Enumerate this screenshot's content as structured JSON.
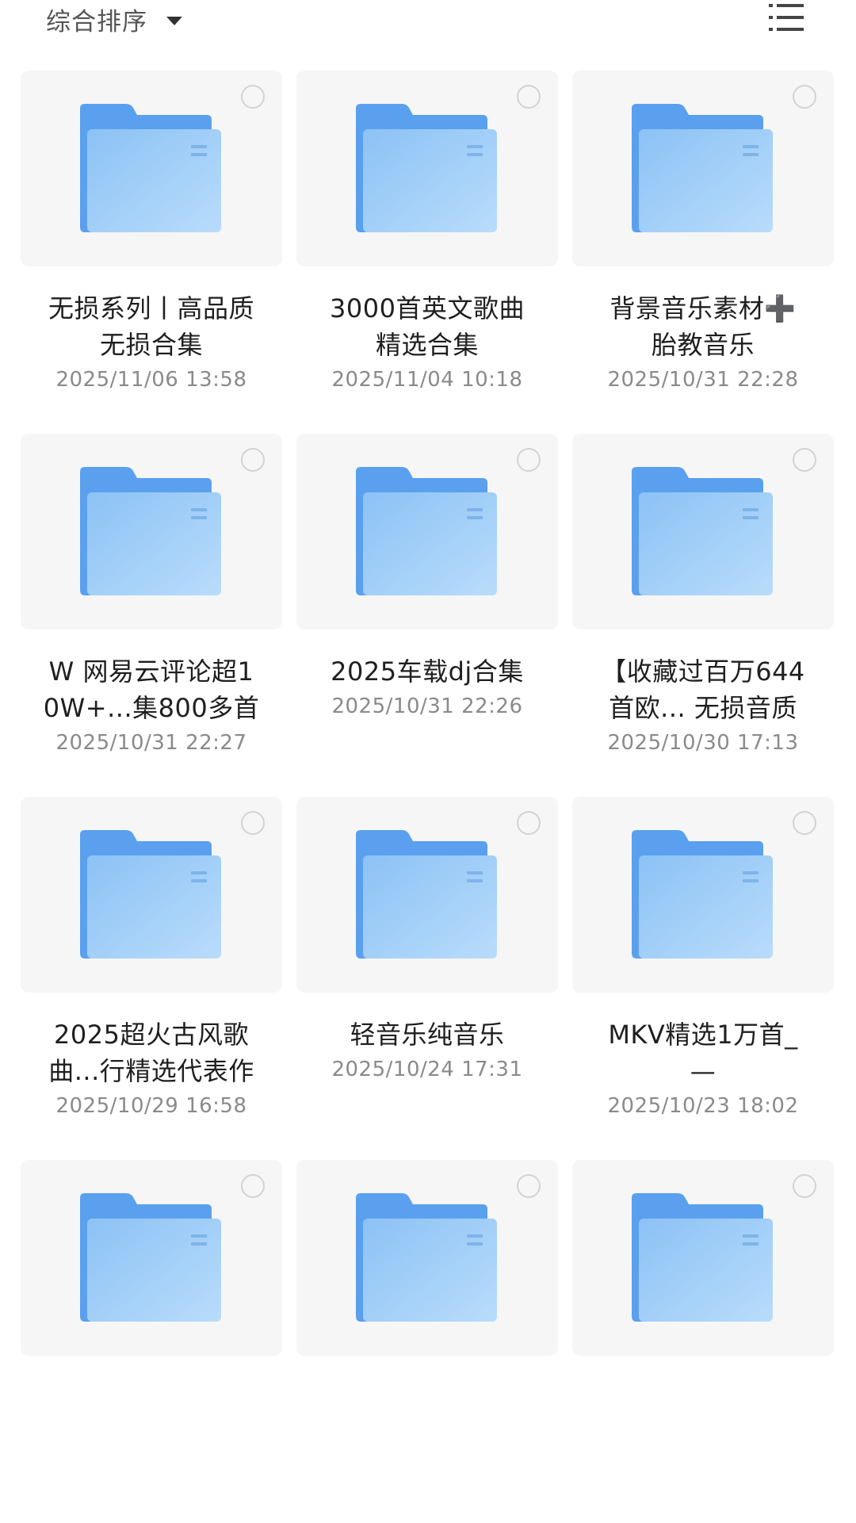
{
  "toolbar": {
    "sort_label": "综合排序",
    "sort_icon": "caret-down-icon",
    "view_toggle_icon": "list-view-icon"
  },
  "colors": {
    "folder_back": "#5aa0ef",
    "folder_front_top": "#8cc2f5",
    "folder_front_bottom": "#b9dcfb",
    "card_bg": "#f6f6f6",
    "select_circle": "#d3d3d3",
    "date_text": "#8a8a8a"
  },
  "folders": [
    {
      "name_lines": [
        "无损系列丨高品质",
        "无损合集"
      ],
      "date": "2025/11/06 13:58"
    },
    {
      "name_lines": [
        "3000首英文歌曲",
        "精选合集"
      ],
      "date": "2025/11/04 10:18"
    },
    {
      "name_lines": [
        "背景音乐素材➕",
        "胎教音乐"
      ],
      "date": "2025/10/31 22:28"
    },
    {
      "name_lines": [
        "W 网易云评论超1",
        "0W+...集800多首"
      ],
      "date": "2025/10/31 22:27"
    },
    {
      "name_lines": [
        "2025车载dj合集"
      ],
      "date": "2025/10/31 22:26"
    },
    {
      "name_lines": [
        "【收藏过百万644",
        "首欧... 无损音质"
      ],
      "date": "2025/10/30 17:13"
    },
    {
      "name_lines": [
        "2025超火古风歌",
        "曲...行精选代表作"
      ],
      "date": "2025/10/29 16:58"
    },
    {
      "name_lines": [
        "轻音乐纯音乐"
      ],
      "date": "2025/10/24 17:31"
    },
    {
      "name_lines": [
        "MKV精选1万首_",
        "—"
      ],
      "date": "2025/10/23 18:02"
    },
    {
      "name_lines": [],
      "date": ""
    },
    {
      "name_lines": [],
      "date": ""
    },
    {
      "name_lines": [],
      "date": ""
    }
  ]
}
